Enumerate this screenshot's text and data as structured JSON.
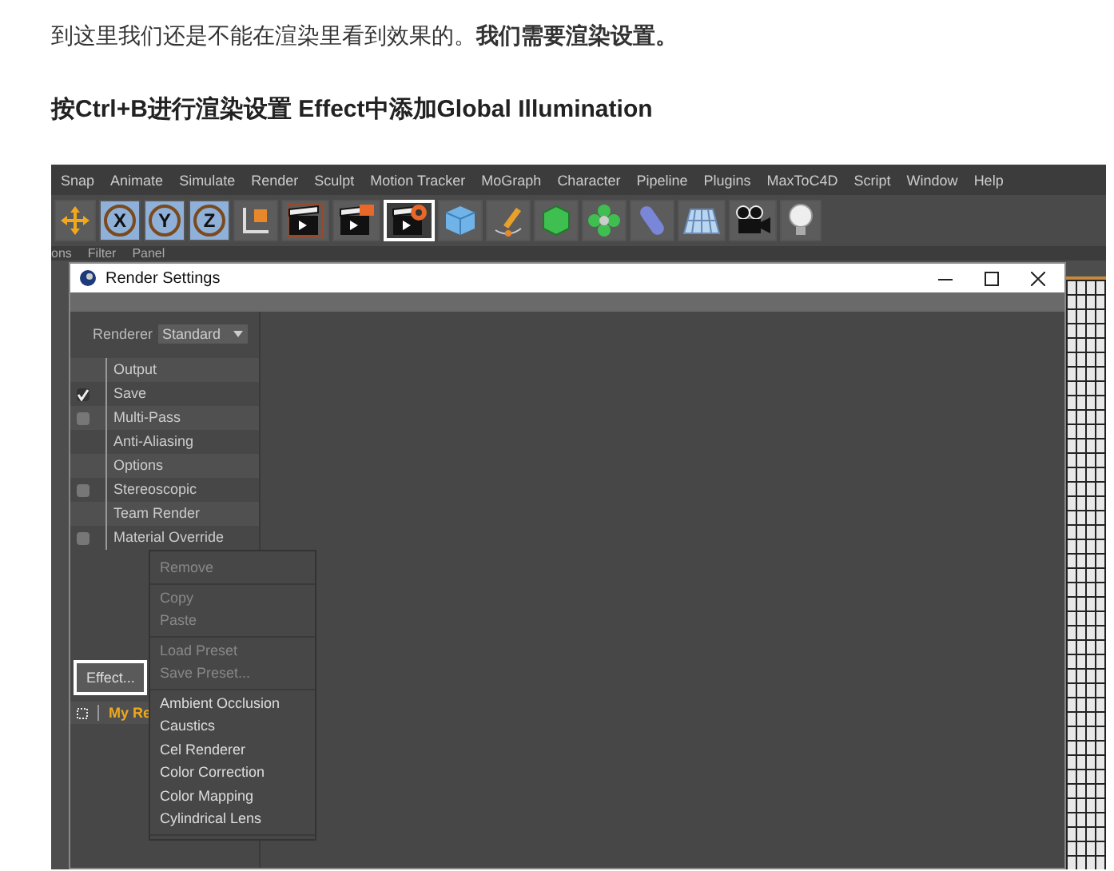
{
  "article": {
    "paragraph": "到这里我们还是不能在渲染里看到效果的。**我们需要渲染设置。**",
    "heading": "按Ctrl+B进行渲染设置 Effect中添加Global Illumination"
  },
  "app": {
    "menu": [
      "Snap",
      "Animate",
      "Simulate",
      "Render",
      "Sculpt",
      "Motion Tracker",
      "MoGraph",
      "Character",
      "Pipeline",
      "Plugins",
      "MaxToC4D",
      "Script",
      "Window",
      "Help"
    ],
    "toolbar": [
      {
        "kind": "move",
        "selected": false
      },
      {
        "kind": "axis",
        "label": "X",
        "selected": false,
        "on": true
      },
      {
        "kind": "axis",
        "label": "Y",
        "selected": false,
        "on": true
      },
      {
        "kind": "axis",
        "label": "Z",
        "selected": false,
        "on": true
      },
      {
        "kind": "coords",
        "selected": false
      },
      {
        "kind": "clapper",
        "selected": false
      },
      {
        "kind": "clapper-edit",
        "selected": false
      },
      {
        "kind": "clapper-gear",
        "selected": true
      },
      {
        "kind": "cube",
        "selected": false
      },
      {
        "kind": "pen",
        "selected": false
      },
      {
        "kind": "green-cube",
        "selected": false
      },
      {
        "kind": "flower",
        "selected": false
      },
      {
        "kind": "capsule",
        "selected": false
      },
      {
        "kind": "floor",
        "selected": false
      },
      {
        "kind": "camera",
        "selected": false
      },
      {
        "kind": "bulb",
        "selected": false
      }
    ],
    "submenu": [
      "ons",
      "Filter",
      "Panel"
    ]
  },
  "window": {
    "title": "Render Settings",
    "renderer_label": "Renderer",
    "renderer_value": "Standard",
    "items": [
      {
        "label": "Output",
        "kind": "plain"
      },
      {
        "label": "Save",
        "kind": "check",
        "checked": true
      },
      {
        "label": "Multi-Pass",
        "kind": "check",
        "checked": false
      },
      {
        "label": "Anti-Aliasing",
        "kind": "plain"
      },
      {
        "label": "Options",
        "kind": "plain"
      },
      {
        "label": "Stereoscopic",
        "kind": "check",
        "checked": false
      },
      {
        "label": "Team Render",
        "kind": "plain"
      },
      {
        "label": "Material Override",
        "kind": "check",
        "checked": false
      }
    ],
    "effect_button": {
      "label": "Effect...",
      "selected": true
    },
    "setting": "My Re"
  },
  "context_menu": {
    "groups": [
      [
        {
          "label": "Remove",
          "disabled": true
        }
      ],
      [
        {
          "label": "Copy",
          "disabled": true
        },
        {
          "label": "Paste",
          "disabled": true
        }
      ],
      [
        {
          "label": "Load Preset",
          "disabled": true
        },
        {
          "label": "Save Preset...",
          "disabled": true
        }
      ],
      [
        {
          "label": "Ambient Occlusion",
          "disabled": false
        },
        {
          "label": "Caustics",
          "disabled": false
        },
        {
          "label": "Cel Renderer",
          "disabled": false
        },
        {
          "label": "Color Correction",
          "disabled": false
        },
        {
          "label": "Color Mapping",
          "disabled": false
        },
        {
          "label": "Cylindrical Lens",
          "disabled": false
        }
      ]
    ]
  }
}
